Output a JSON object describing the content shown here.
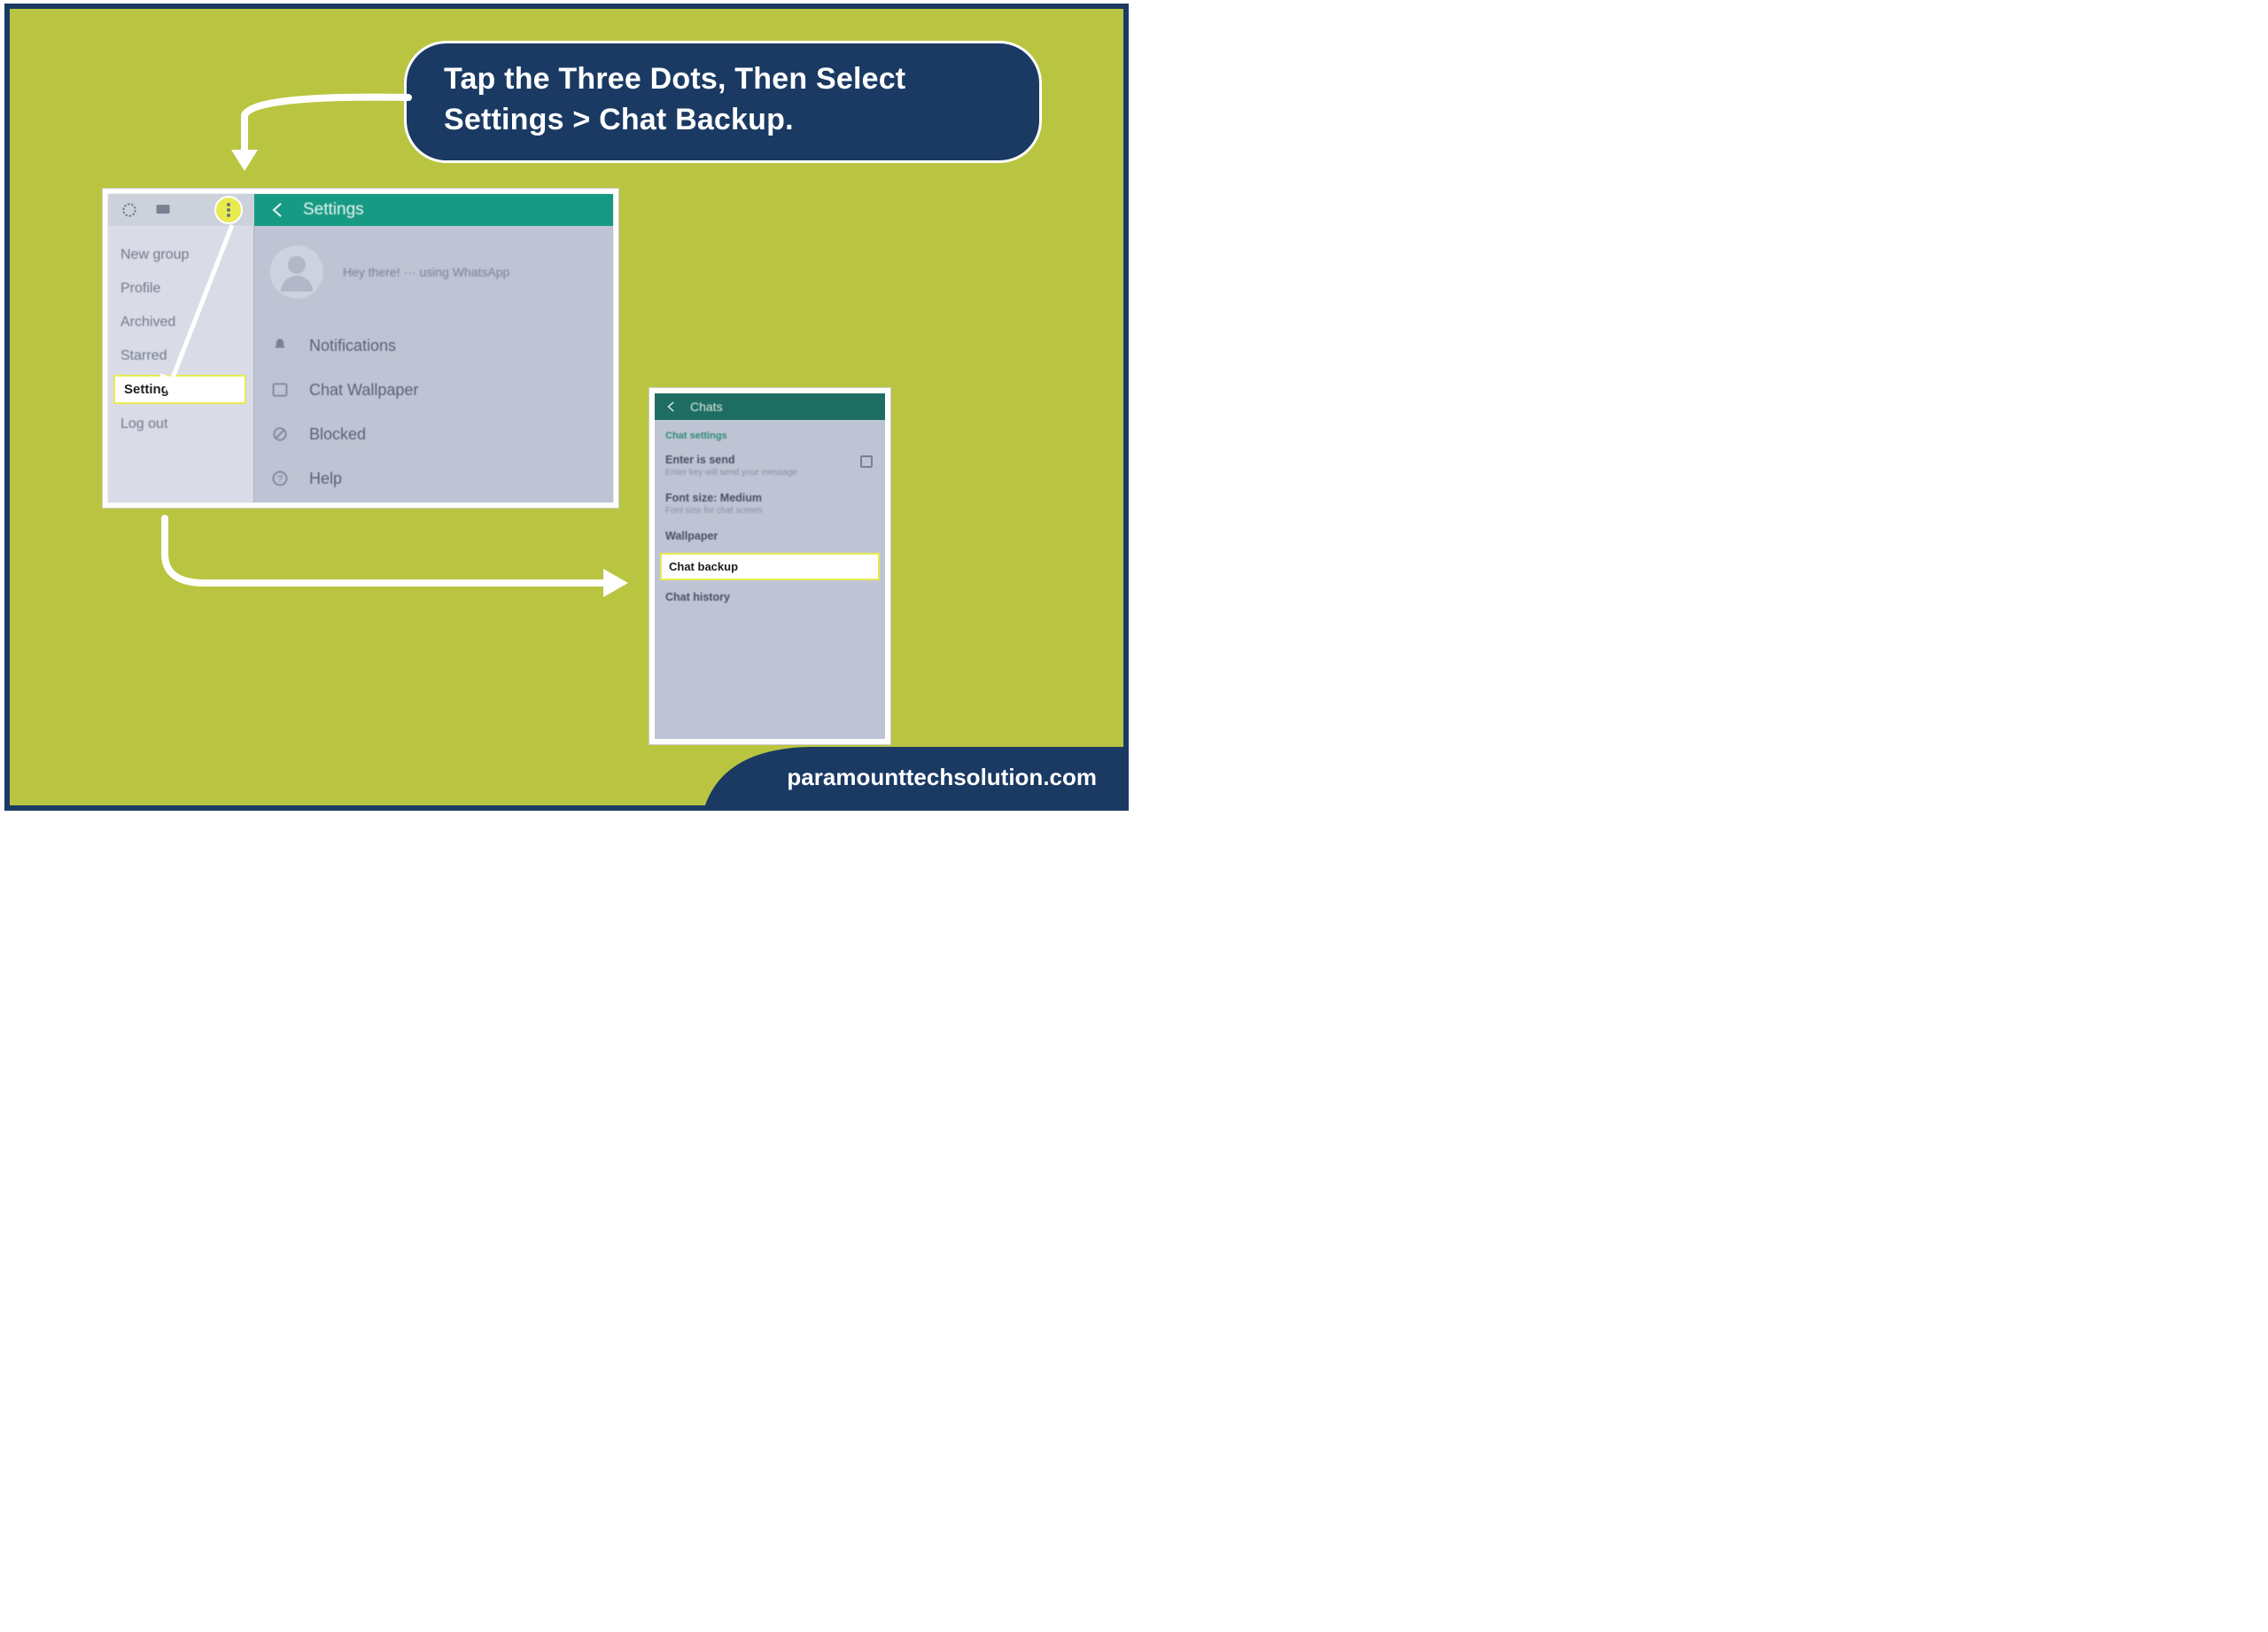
{
  "instruction": "Tap the Three Dots, Then Select Settings > Chat Backup.",
  "footer": "paramounttechsolution.com",
  "shot1": {
    "topbar_title": "Settings",
    "profile_status": "Hey there! ··· using WhatsApp",
    "menu": {
      "items": [
        "New group",
        "Profile",
        "Archived",
        "Starred",
        "Settings",
        "Log out"
      ],
      "highlight_index": 4
    },
    "settings_rows": [
      {
        "icon": "bell-icon",
        "label": "Notifications"
      },
      {
        "icon": "image-icon",
        "label": "Chat Wallpaper"
      },
      {
        "icon": "blocked-icon",
        "label": "Blocked"
      },
      {
        "icon": "help-icon",
        "label": "Help"
      }
    ]
  },
  "shot2": {
    "topbar_title": "Chats",
    "section_label": "Chat settings",
    "rows": [
      {
        "title": "Enter is send",
        "sub": "Enter key will send your message",
        "checkbox": true
      },
      {
        "title": "Font size: Medium",
        "sub": "Font size for chat screen"
      },
      {
        "title": "Wallpaper"
      },
      {
        "title": "Chat backup",
        "highlight": true
      },
      {
        "title": "Chat history"
      }
    ]
  }
}
